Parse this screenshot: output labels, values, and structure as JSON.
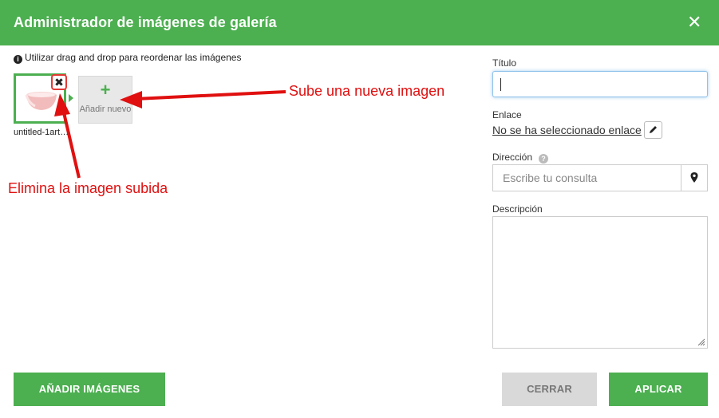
{
  "dialog": {
    "title": "Administrador de imágenes de galería",
    "close_label": "✕"
  },
  "gallery": {
    "hint": "Utilizar drag and drop para reordenar las imágenes",
    "items": [
      {
        "filename": "untitled-1art…",
        "delete_label": "✖"
      }
    ],
    "add_tile": {
      "plus": "+",
      "label": "Añadir nuevo"
    }
  },
  "annotations": {
    "upload": "Sube una nueva imagen",
    "delete": "Elimina la imagen subida",
    "color": "#e01010"
  },
  "form": {
    "title_label": "Título",
    "title_value": "",
    "link_label": "Enlace",
    "link_value": "No se ha seleccionado enlace",
    "address_label": "Dirección",
    "address_placeholder": "Escribe tu consulta",
    "description_label": "Descripción",
    "description_value": ""
  },
  "footer": {
    "add_images": "AÑADIR IMÁGENES",
    "close": "CERRAR",
    "apply": "APLICAR"
  },
  "colors": {
    "accent": "#4caf50",
    "disabled": "#d9d9d9"
  },
  "icons": {
    "info": "info-circle-icon",
    "pencil": "pencil-icon",
    "map_marker": "map-marker-icon",
    "help": "question-circle-icon"
  }
}
